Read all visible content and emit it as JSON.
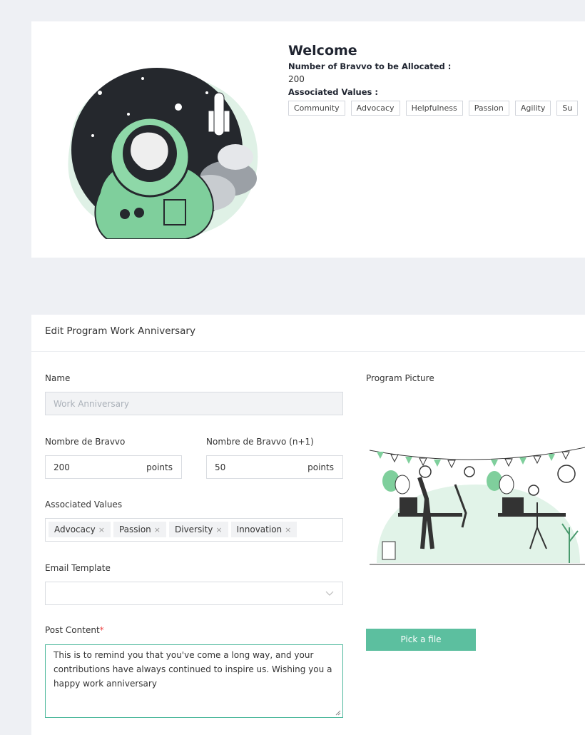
{
  "welcome": {
    "title": "Welcome",
    "bravvo_label": "Number of Bravvo to be Allocated :",
    "bravvo_value": "200",
    "values_label": "Associated Values :",
    "values": [
      "Community",
      "Advocacy",
      "Helpfulness",
      "Passion",
      "Agility",
      "Su"
    ]
  },
  "edit": {
    "header": "Edit Program Work Anniversary",
    "name_label": "Name",
    "name_placeholder": "Work Anniversary",
    "bravvo_label": "Nombre de Bravvo",
    "bravvo_value": "200",
    "bravvo_suffix": "points",
    "bravvo_n1_label": "Nombre de Bravvo (n+1)",
    "bravvo_n1_value": "50",
    "bravvo_n1_suffix": "points",
    "values_label": "Associated Values",
    "values": [
      "Advocacy",
      "Passion",
      "Diversity",
      "Innovation"
    ],
    "chip_remove": "×",
    "email_label": "Email Template",
    "email_value": "",
    "post_label": "Post Content",
    "post_required": "*",
    "post_content": "This is to remind you that you've come a long way, and your contributions have always continued to inspire us. Wishing you a happy work anniversary",
    "picture_label": "Program Picture",
    "pick_button": "Pick a file"
  },
  "colors": {
    "accent": "#5cbf9f",
    "accent_light": "#cdebd9",
    "background": "#eef0f4"
  },
  "icons": [
    "chevron-down-icon",
    "close-icon",
    "resize-handle-icon"
  ]
}
